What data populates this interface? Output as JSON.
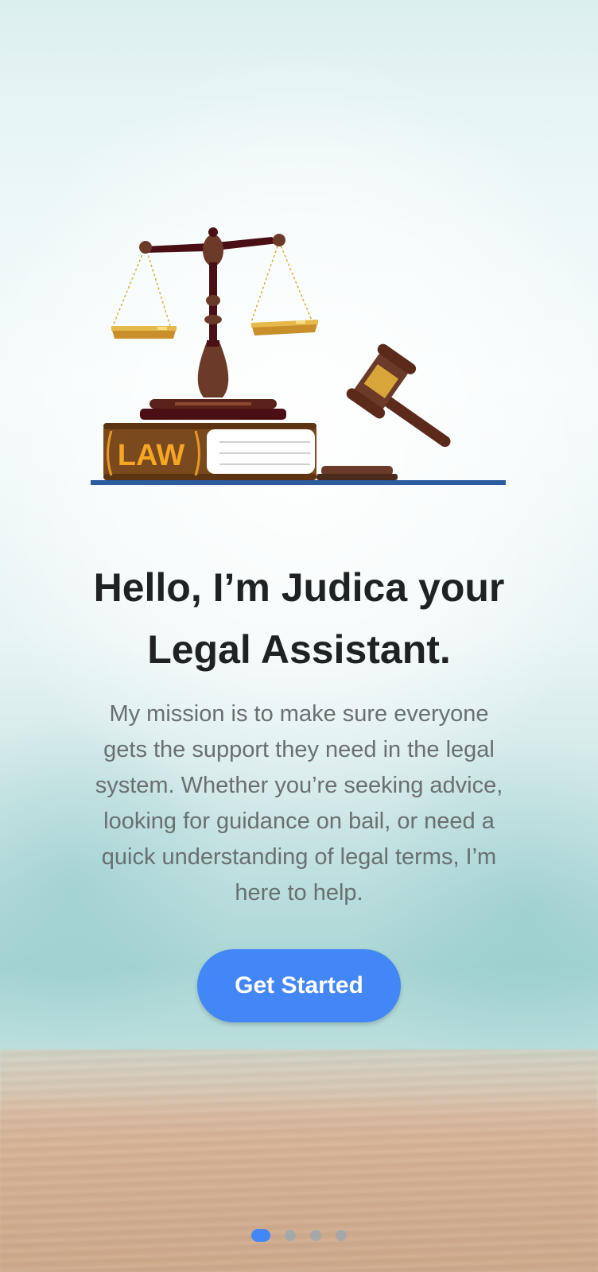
{
  "hero": {
    "illustration": "scales-of-justice-gavel-law-book",
    "book_label": "LAW"
  },
  "onboarding": {
    "title_line1": "Hello, I’m Judica your",
    "title_line2": "Legal Assistant.",
    "description_lines": [
      "My mission is to make sure everyone",
      "gets the support they need in the legal",
      "system. Whether you’re seeking advice,",
      "looking for guidance on bail, or need a",
      "quick understanding of legal terms, I’m",
      "here to help."
    ],
    "cta_label": "Get Started"
  },
  "pagination": {
    "total": 4,
    "current": 1
  },
  "colors": {
    "primary": "#4287f5",
    "title": "#1f2224",
    "body_text": "#6a6f70",
    "book_brown": "#7a4a1e",
    "book_label": "#f5a623",
    "scale_dark": "#4a0f14",
    "gold": "#d8a53a"
  }
}
